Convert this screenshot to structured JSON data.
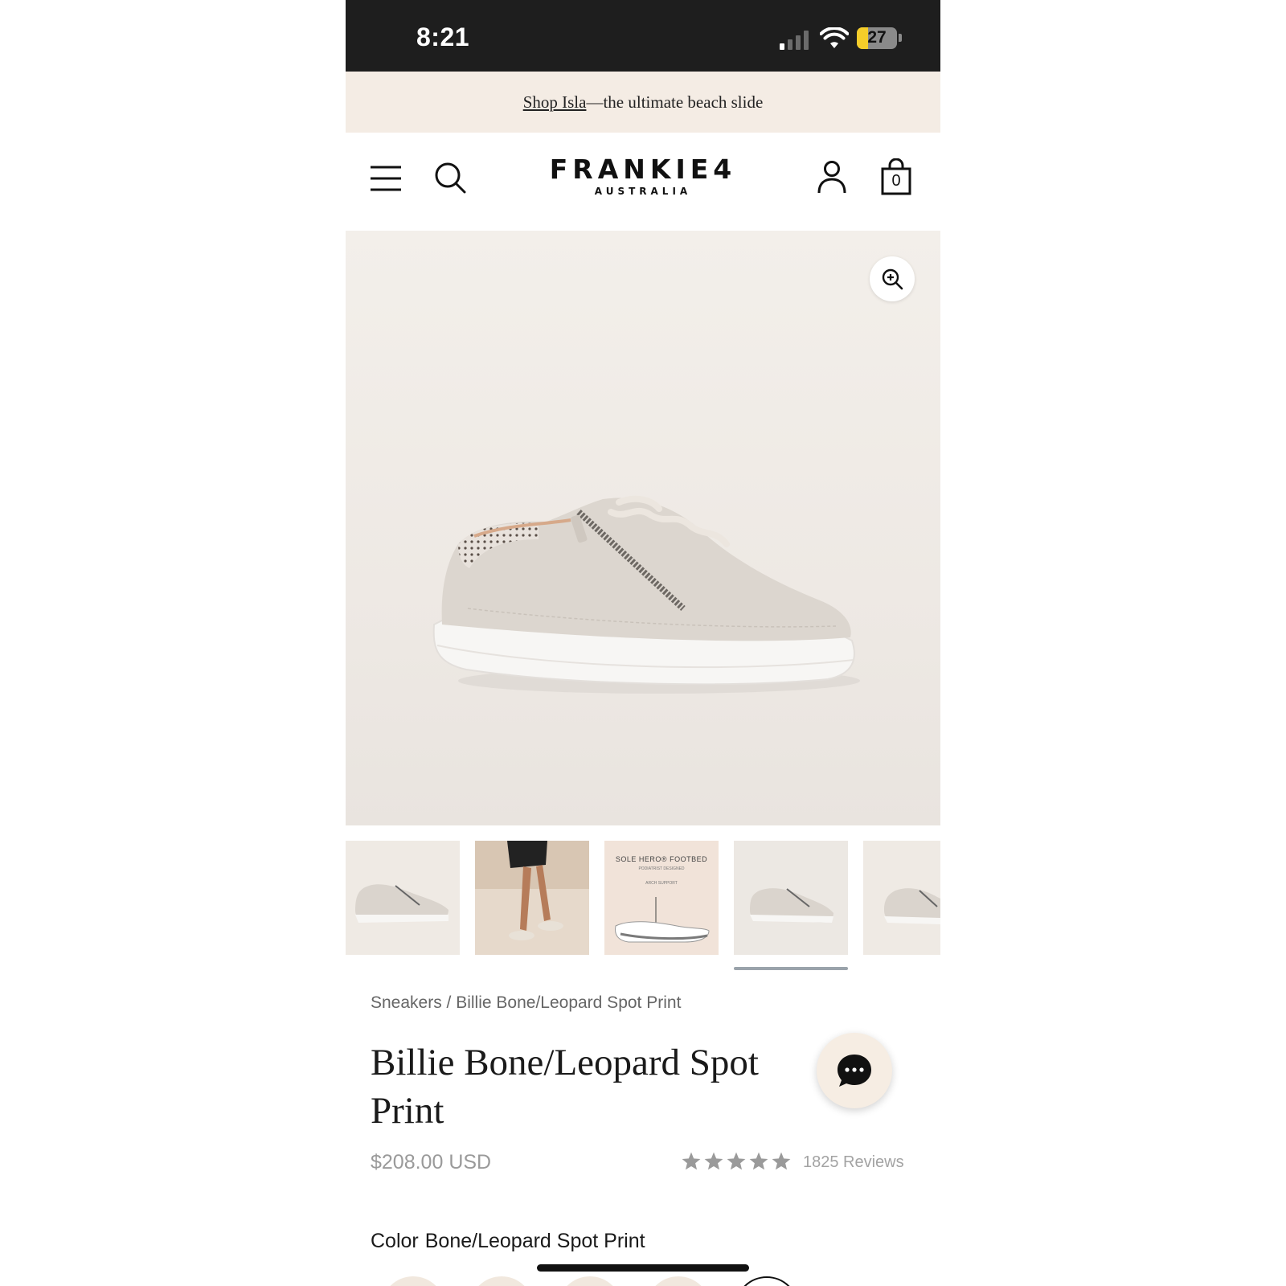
{
  "status_bar": {
    "time": "8:21",
    "battery_percent": "27",
    "battery_level": 0.27,
    "signal_bars_active": 1
  },
  "promo": {
    "link_text": "Shop Isla",
    "rest_text": "—the ultimate beach slide"
  },
  "header": {
    "brand": "FRANKIE4",
    "brand_sub": "AUSTRALIA",
    "cart_count": "0",
    "icons": [
      "menu-icon",
      "search-icon",
      "account-icon",
      "bag-icon"
    ]
  },
  "gallery": {
    "zoom_icon": "zoom-in-icon",
    "thumbnail_count": 5,
    "selected_thumbnail": 4,
    "thumb3_title": "SOLE HERO® FOOTBED",
    "thumb3_sub": "PODIATRIST DESIGNED",
    "thumb3_label": "ARCH SUPPORT"
  },
  "product": {
    "breadcrumb": "Sneakers / Billie Bone/Leopard Spot Print",
    "title": "Billie Bone/Leopard Spot Print",
    "price": "$208.00 USD",
    "rating": 5,
    "reviews": "1825 Reviews",
    "color_label": "Color",
    "color_value": "Bone/Leopard Spot Print"
  },
  "colors": {
    "status_bar_bg": "#1e1e1e",
    "promo_bg": "#f4ece4",
    "battery_fill": "#f5cd2a",
    "chat_bg": "#f6ede3",
    "star": "#9a9a9a"
  }
}
